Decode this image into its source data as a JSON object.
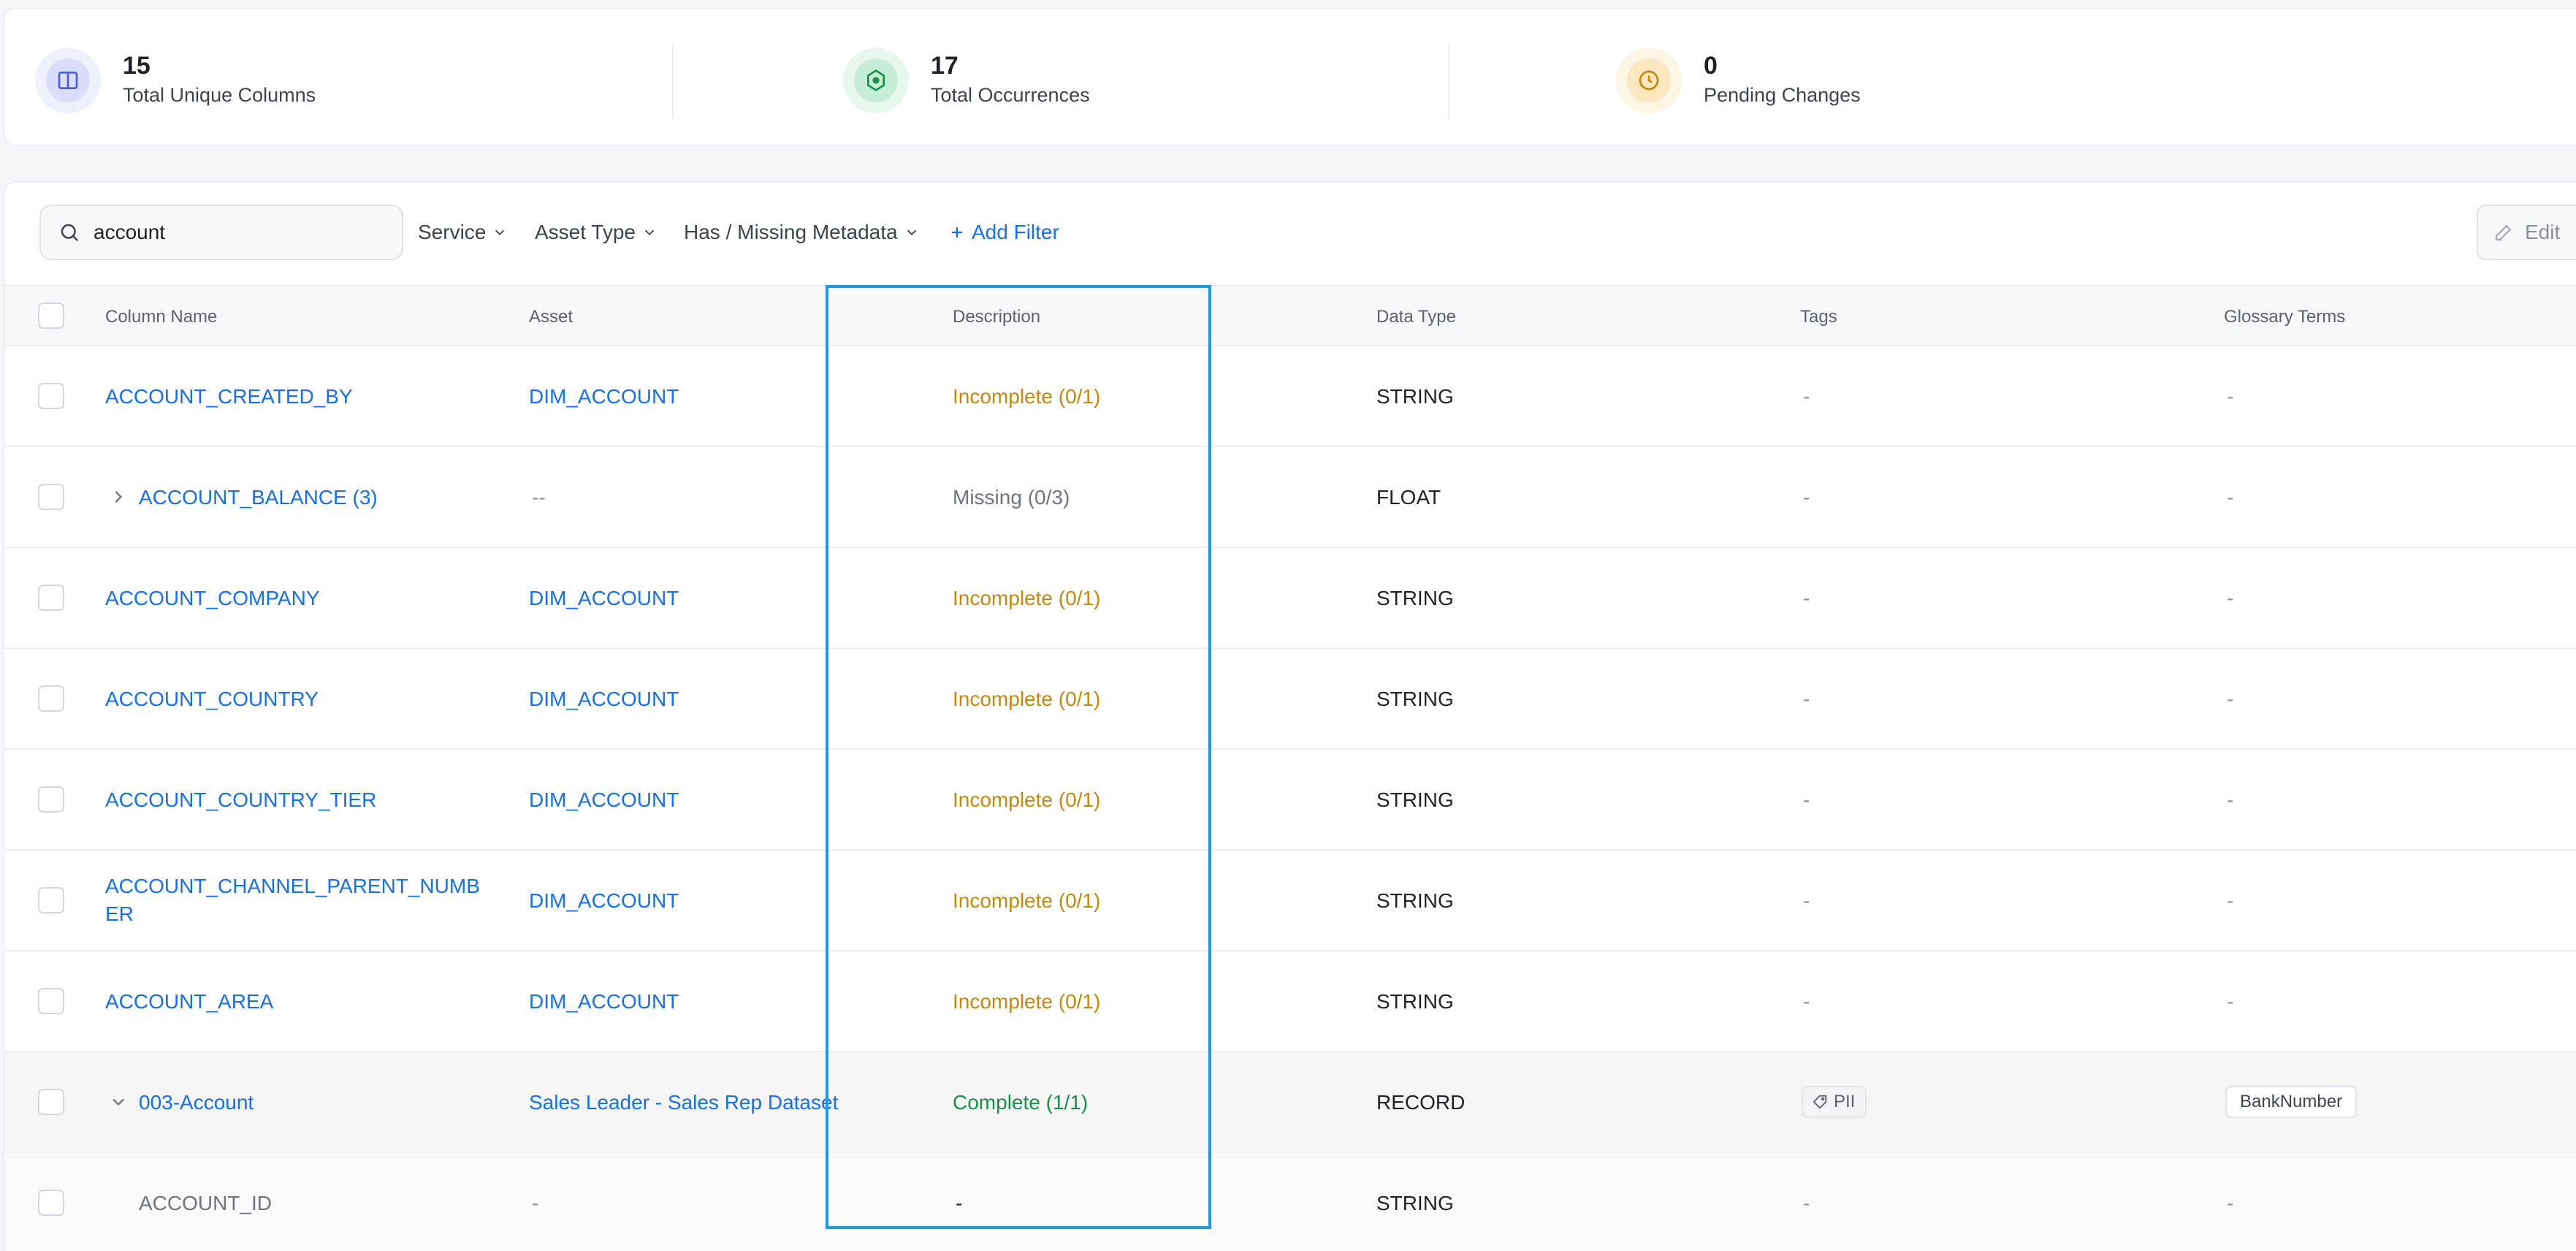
{
  "stats": [
    {
      "value": "15",
      "label": "Total Unique Columns",
      "icon": "columns-icon",
      "color": "#4a5fd6"
    },
    {
      "value": "17",
      "label": "Total Occurrences",
      "icon": "target-icon",
      "color": "#16924a"
    },
    {
      "value": "0",
      "label": "Pending Changes",
      "icon": "clock-icon",
      "color": "#c7870a"
    }
  ],
  "toolbar": {
    "search_value": "account",
    "filters": [
      "Service",
      "Asset Type",
      "Has / Missing Metadata"
    ],
    "add_filter": "Add Filter",
    "edit": "Edit"
  },
  "columns": [
    "Column Name",
    "Asset",
    "Description",
    "Data Type",
    "Tags",
    "Glossary Terms"
  ],
  "rows": [
    {
      "name": "ACCOUNT_CREATED_BY",
      "asset": "DIM_ACCOUNT",
      "description": "Incomplete (0/1)",
      "type": "STRING",
      "tags": "-",
      "glossary": "-"
    },
    {
      "name": "ACCOUNT_BALANCE (3)",
      "asset": "--",
      "description": "Missing (0/3)",
      "type": "FLOAT",
      "tags": "-",
      "glossary": "-"
    },
    {
      "name": "ACCOUNT_COMPANY",
      "asset": "DIM_ACCOUNT",
      "description": "Incomplete (0/1)",
      "type": "STRING",
      "tags": "-",
      "glossary": "-"
    },
    {
      "name": "ACCOUNT_COUNTRY",
      "asset": "DIM_ACCOUNT",
      "description": "Incomplete (0/1)",
      "type": "STRING",
      "tags": "-",
      "glossary": "-"
    },
    {
      "name": "ACCOUNT_COUNTRY_TIER",
      "asset": "DIM_ACCOUNT",
      "description": "Incomplete (0/1)",
      "type": "STRING",
      "tags": "-",
      "glossary": "-"
    },
    {
      "name_line1": "ACCOUNT_CHANNEL_PARENT_NUMB",
      "name_line2": "ER",
      "asset": "DIM_ACCOUNT",
      "description": "Incomplete (0/1)",
      "type": "STRING",
      "tags": "-",
      "glossary": "-"
    },
    {
      "name": "ACCOUNT_AREA",
      "asset": "DIM_ACCOUNT",
      "description": "Incomplete (0/1)",
      "type": "STRING",
      "tags": "-",
      "glossary": "-"
    },
    {
      "name": "003-Account",
      "asset": "Sales Leader - Sales Rep Dataset",
      "description": "Complete (1/1)",
      "type": "RECORD",
      "tag_label": "PII",
      "glossary_term": "BankNumber"
    },
    {
      "name": "ACCOUNT_ID",
      "asset": "-",
      "description": "-",
      "type": "STRING",
      "tags": "-",
      "glossary": "-"
    }
  ]
}
